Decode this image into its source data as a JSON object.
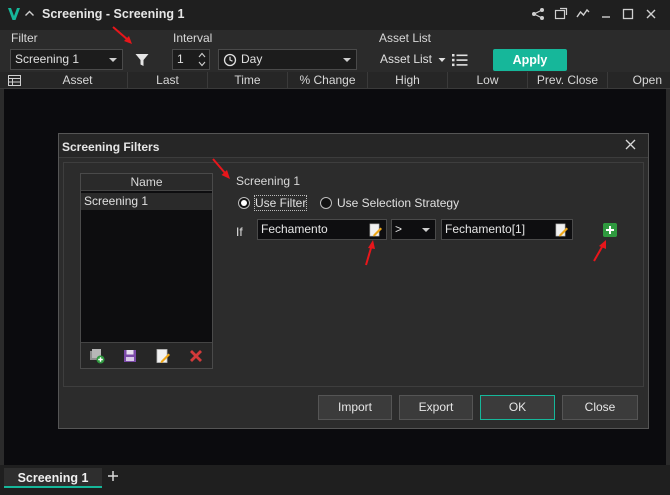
{
  "window": {
    "title": "Screening - Screening 1"
  },
  "toolbar": {
    "filter_label": "Filter",
    "filter_value": "Screening 1",
    "interval_label": "Interval",
    "interval_number": "1",
    "interval_unit": "Day",
    "asset_list_label": "Asset List",
    "asset_list_button": "Asset List",
    "apply_button": "Apply"
  },
  "columns": [
    "Asset",
    "Last",
    "Time",
    "% Change",
    "High",
    "Low",
    "Prev. Close",
    "Open"
  ],
  "dialog": {
    "title": "Screening Filters",
    "list_header": "Name",
    "list_items": [
      "Screening 1"
    ],
    "rule_name": "Screening 1",
    "radio_use_filter": "Use Filter",
    "radio_use_strategy": "Use Selection Strategy",
    "if_label": "If",
    "left_operand": "Fechamento",
    "operator": ">",
    "right_operand": "Fechamento[1]",
    "buttons": {
      "import": "Import",
      "export": "Export",
      "ok": "OK",
      "close": "Close"
    }
  },
  "tabs": {
    "sheet": "Screening 1"
  },
  "colors": {
    "accent": "#16b79a",
    "annotation_arrow": "#e8161b",
    "background": "#0b0b0e"
  }
}
